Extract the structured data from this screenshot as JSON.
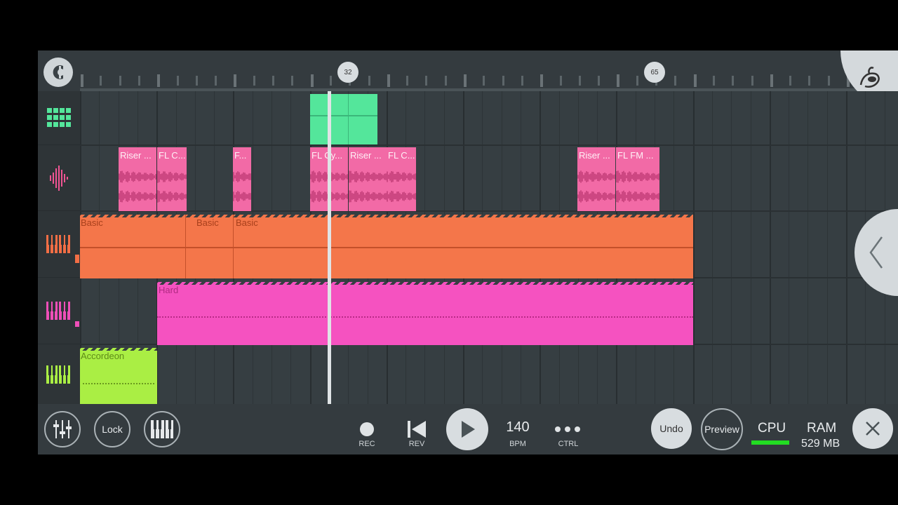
{
  "ruler": {
    "marker_32": "32",
    "marker_65": "65"
  },
  "icons": {
    "magnet": "magnet-icon",
    "logo": "fl-studio-logo-icon",
    "collapse": "chevron-left-icon",
    "mixer": "mixer-icon",
    "piano": "piano-icon",
    "close": "close-icon",
    "record": "record-icon",
    "rewind": "rewind-icon",
    "play": "play-icon"
  },
  "tracks": [
    {
      "name": "drum-pattern",
      "icon": "step-sequencer-icon",
      "color": "#54e69b"
    },
    {
      "name": "audio",
      "icon": "waveform-icon",
      "color": "#f05493"
    },
    {
      "name": "orange-synth",
      "icon": "keyboard-icon",
      "color": "#f26e45"
    },
    {
      "name": "pink-synth",
      "icon": "keyboard-icon",
      "color": "#ef4fb8"
    },
    {
      "name": "green-synth",
      "icon": "keyboard-icon",
      "color": "#aaee44"
    }
  ],
  "clips": {
    "audio": [
      "Riser ...",
      "FL C...",
      "F...",
      "FL Cy...",
      "Riser ...",
      "FL C...",
      "Riser ...",
      "FL FM ..."
    ],
    "basic": [
      "Basic",
      "Basic",
      "Basic"
    ],
    "hard": "Hard",
    "accordeon": "Accordeon"
  },
  "toolbar": {
    "lock": "Lock",
    "rec": "REC",
    "rev": "REV",
    "bpm_value": "140",
    "bpm_label": "BPM",
    "ctrl_label": "CTRL",
    "undo": "Undo",
    "preview": "Preview",
    "cpu_label": "CPU",
    "ram_label": "RAM",
    "ram_value": "529 MB",
    "cpu_color": "#22dd22"
  }
}
